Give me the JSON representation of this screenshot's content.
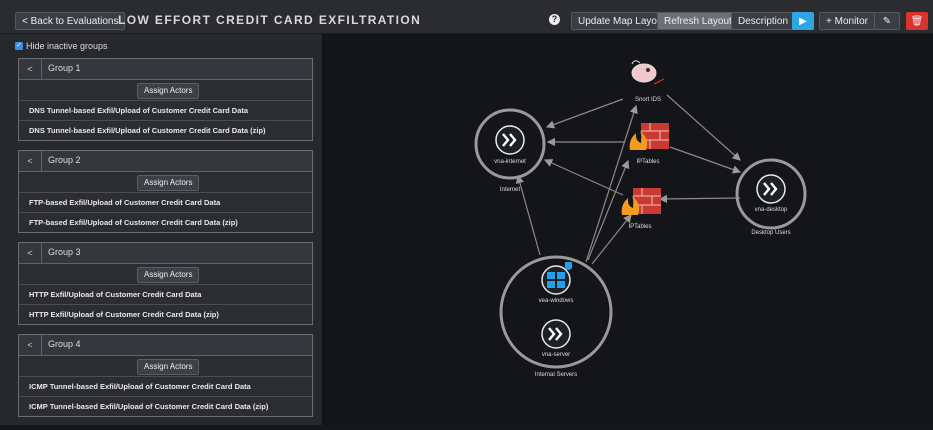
{
  "header": {
    "back_label": "< Back to Evaluations",
    "title": "LOW EFFORT CREDIT CARD EXFILTRATION",
    "help": "?",
    "update_layout": "Update Map Layout ▾",
    "refresh_layout": "Refresh Layout",
    "description": "Description",
    "monitor": "+ Monitor"
  },
  "sidebar": {
    "hide_inactive": "Hide inactive groups",
    "assign_label": "Assign Actors",
    "groups": [
      {
        "name": "Group 1",
        "actions": [
          "DNS Tunnel-based Exfil/Upload of Customer Credit Card Data",
          "DNS Tunnel-based Exfil/Upload of Customer Credit Card Data (zip)"
        ]
      },
      {
        "name": "Group 2",
        "actions": [
          "FTP-based Exfil/Upload of Customer Credit Card Data",
          "FTP-based Exfil/Upload of Customer Credit Card Data (zip)"
        ]
      },
      {
        "name": "Group 3",
        "actions": [
          "HTTP Exfil/Upload of Customer Credit Card Data",
          "HTTP Exfil/Upload of Customer Credit Card Data (zip)"
        ]
      },
      {
        "name": "Group 4",
        "actions": [
          "ICMP Tunnel-based Exfil/Upload of Customer Credit Card Data",
          "ICMP Tunnel-based Exfil/Upload of Customer Credit Card Data (zip)"
        ]
      }
    ]
  },
  "map": {
    "nodes": {
      "snort": "Snort IDS",
      "iptables1": "IPTables",
      "iptables2": "IPTables",
      "internet": "vna-internet",
      "internet_group": "Internet",
      "desktop": "vna-desktop",
      "desktop_group": "Desktop Users",
      "windows": "vea-windows",
      "server": "vna-server",
      "servers_group": "Internal Servers"
    }
  },
  "colors": {
    "accent_blue": "#2ea6e6",
    "danger_red": "#d9332f",
    "firewall_red": "#c93a32"
  }
}
